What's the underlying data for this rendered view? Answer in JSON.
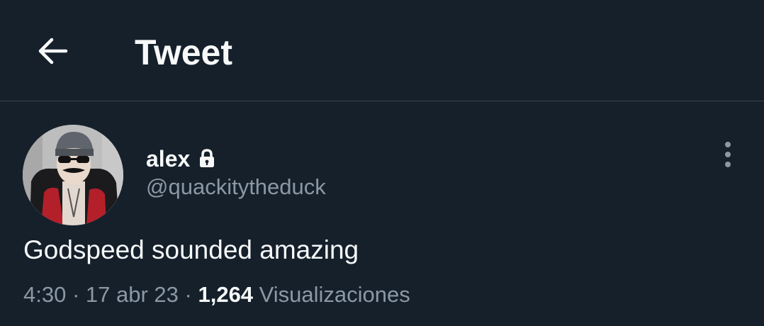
{
  "header": {
    "back_icon": "arrow-left-icon",
    "title": "Tweet"
  },
  "tweet": {
    "author": {
      "name": "alex",
      "protected_icon": "lock-icon",
      "handle": "@quackitytheduck"
    },
    "more_icon": "vertical-ellipsis-icon",
    "text": "Godspeed sounded amazing",
    "meta": {
      "time": "4:30",
      "separator": " · ",
      "date": "17 abr 23",
      "views_count": "1,264",
      "views_label": " Visualizaciones"
    }
  },
  "colors": {
    "background": "#15202b",
    "primary_text": "#f7f9f9",
    "secondary_text": "#8b98a5",
    "divider": "#38444d"
  }
}
